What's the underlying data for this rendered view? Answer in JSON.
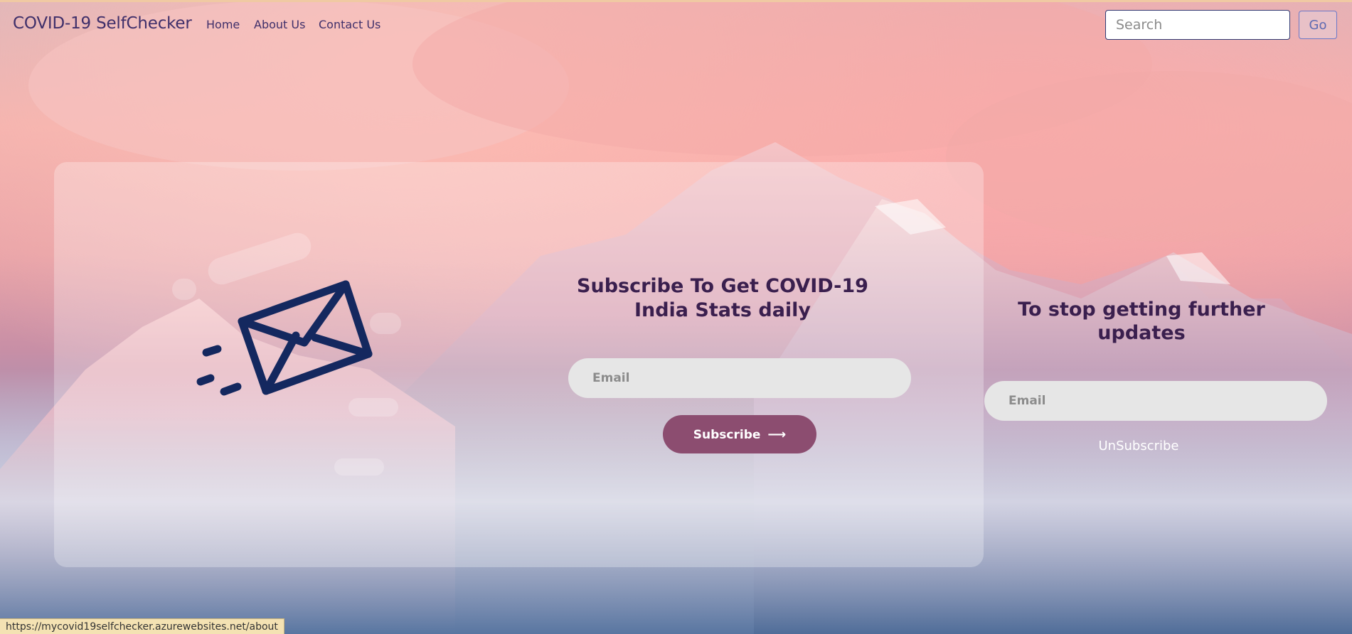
{
  "navbar": {
    "brand": "COVID-19 SelfChecker",
    "links": [
      "Home",
      "About Us",
      "Contact Us"
    ],
    "search_placeholder": "Search",
    "go_label": "Go"
  },
  "subscribe": {
    "title": "Subscribe To Get COVID-19 India Stats daily",
    "email_placeholder": "Email",
    "button_label": "Subscribe",
    "button_arrow": "⟶"
  },
  "unsubscribe": {
    "title": "To stop getting further updates",
    "email_placeholder": "Email",
    "link_label": "UnSubscribe"
  },
  "status_bar": {
    "url": "https://mycovid19selfchecker.azurewebsites.net/about"
  },
  "colors": {
    "brand_text": "#3f2f6a",
    "subscribe_button": "#8c4d70",
    "heading_text": "#3a1f4e",
    "envelope": "#14285f"
  },
  "icons": {
    "hero": "envelope-icon"
  }
}
